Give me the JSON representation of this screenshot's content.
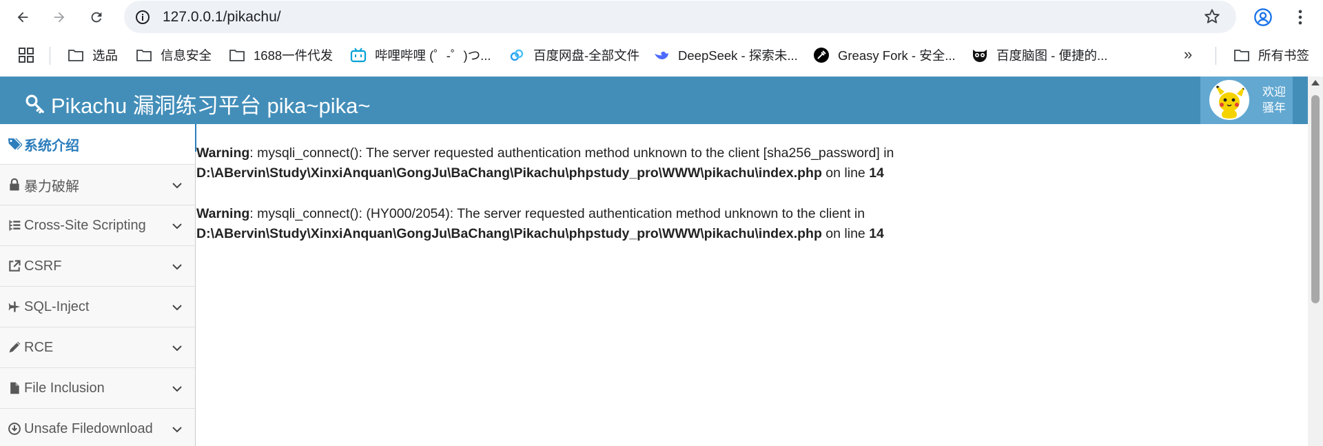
{
  "browser": {
    "url": "127.0.0.1/pikachu/",
    "bookmarks": [
      {
        "label": "选品",
        "icon": "folder-icon"
      },
      {
        "label": "信息安全",
        "icon": "folder-icon"
      },
      {
        "label": "1688一件代发",
        "icon": "folder-icon"
      },
      {
        "label": "哔哩哔哩 (゜-゜)つ...",
        "icon": "bilibili-icon"
      },
      {
        "label": "百度网盘-全部文件",
        "icon": "baidu-netdisk-icon"
      },
      {
        "label": "DeepSeek - 探索未...",
        "icon": "deepseek-icon"
      },
      {
        "label": "Greasy Fork - 安全...",
        "icon": "greasyfork-icon"
      },
      {
        "label": "百度脑图 - 便捷的...",
        "icon": "baidu-naotu-icon"
      }
    ],
    "all_bookmarks": "所有书签"
  },
  "app": {
    "title": "Pikachu 漏洞练习平台 pika~pika~",
    "user": {
      "line1": "欢迎",
      "line2": "骚年"
    }
  },
  "sidebar": {
    "items": [
      {
        "label": "系统介绍",
        "icon": "tags-icon",
        "active": true
      },
      {
        "label": "暴力破解",
        "icon": "lock-icon"
      },
      {
        "label": "Cross-Site Scripting",
        "icon": "list-tree-icon"
      },
      {
        "label": "CSRF",
        "icon": "share-icon"
      },
      {
        "label": "SQL-Inject",
        "icon": "plane-icon"
      },
      {
        "label": "RCE",
        "icon": "pencil-icon"
      },
      {
        "label": "File Inclusion",
        "icon": "file-icon"
      },
      {
        "label": "Unsafe Filedownload",
        "icon": "download-circle-icon"
      }
    ]
  },
  "warnings": [
    {
      "label": "Warning",
      "message": ": mysqli_connect(): The server requested authentication method unknown to the client [sha256_password] in",
      "path": "D:\\ABervin\\Study\\XinxiAnquan\\GongJu\\BaChang\\Pikachu\\phpstudy_pro\\WWW\\pikachu\\index.php",
      "on_line": " on line ",
      "line": "14"
    },
    {
      "label": "Warning",
      "message": ": mysqli_connect(): (HY000/2054): The server requested authentication method unknown to the client in",
      "path": "D:\\ABervin\\Study\\XinxiAnquan\\GongJu\\BaChang\\Pikachu\\phpstudy_pro\\WWW\\pikachu\\index.php",
      "on_line": " on line ",
      "line": "14"
    }
  ],
  "colors": {
    "header": "#438eb9",
    "user_box": "#62a8d1",
    "active_link": "#2b7dbc"
  }
}
